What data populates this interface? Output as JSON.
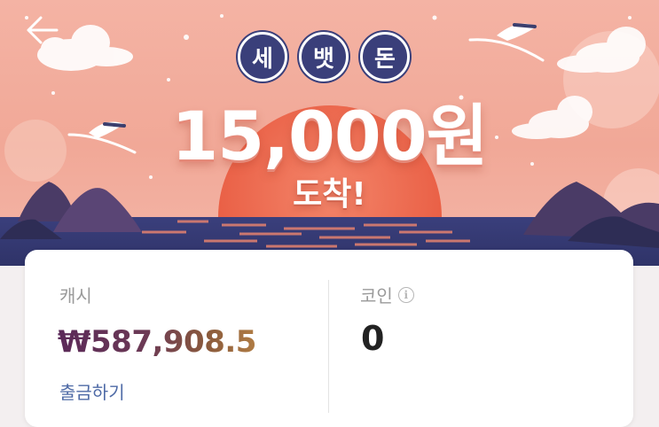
{
  "banner": {
    "badges": [
      "세",
      "뱃",
      "돈"
    ],
    "amount": "15,000원",
    "arrive": "도착!"
  },
  "icons": {
    "back": "back-arrow-icon",
    "info": "info-icon"
  },
  "wallet": {
    "cash_label": "캐시",
    "cash_value": "₩587,908.5",
    "withdraw_label": "출금하기",
    "coin_label": "코인",
    "coin_value": "0",
    "info_glyph": "i"
  },
  "colors": {
    "badge_bg": "#3a3f7a",
    "sun": "#ec6a4e",
    "sea": "#3b4382",
    "withdraw_link": "#4e6aa6"
  }
}
